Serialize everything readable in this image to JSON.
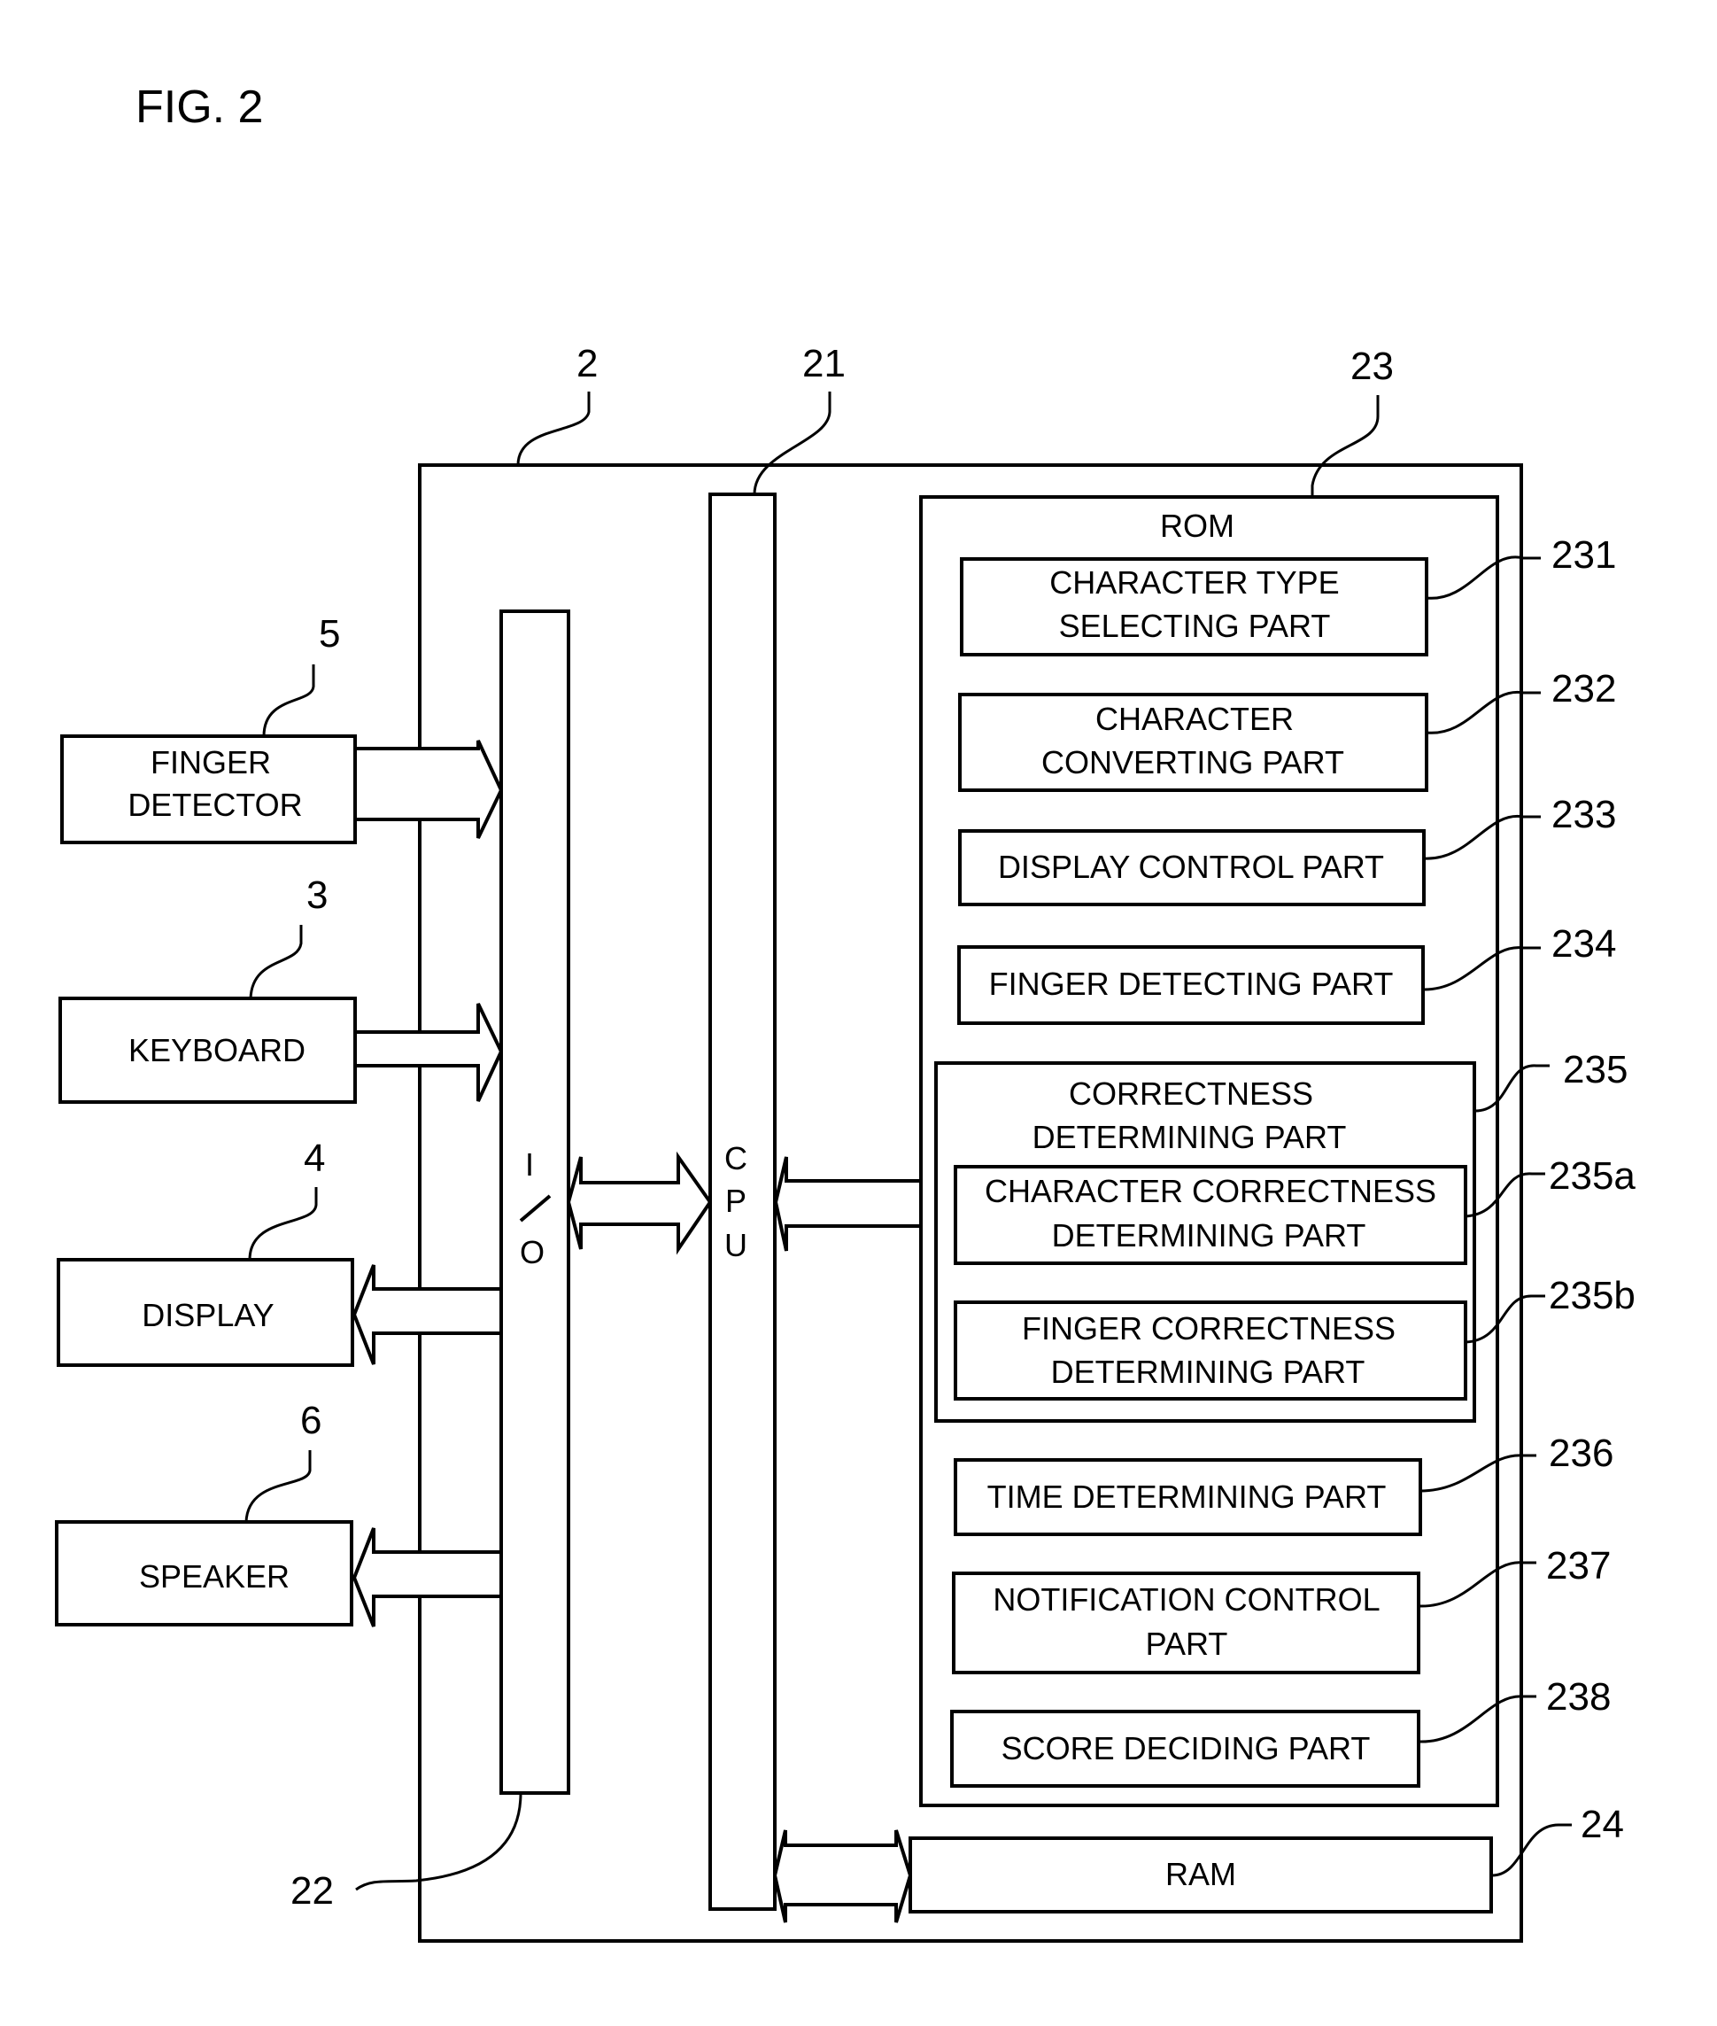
{
  "figure": {
    "title": "FIG. 2"
  },
  "refs": {
    "controller": "2",
    "cpu": "21",
    "io": "22",
    "rom": "23",
    "ram": "24",
    "finger_detector": "5",
    "keyboard": "3",
    "display": "4",
    "speaker": "6",
    "p231": "231",
    "p232": "232",
    "p233": "233",
    "p234": "234",
    "p235": "235",
    "p235a": "235a",
    "p235b": "235b",
    "p236": "236",
    "p237": "237",
    "p238": "238"
  },
  "blocks": {
    "finger_detector": [
      "FINGER",
      "DETECTOR"
    ],
    "keyboard": [
      "KEYBOARD"
    ],
    "display": [
      "DISPLAY"
    ],
    "speaker": [
      "SPEAKER"
    ],
    "io": [
      "I",
      "/",
      "O"
    ],
    "cpu": [
      "C",
      "P",
      "U"
    ],
    "rom": "ROM",
    "ram": "RAM",
    "p231": [
      "CHARACTER TYPE",
      "SELECTING PART"
    ],
    "p232": [
      "CHARACTER",
      "CONVERTING PART"
    ],
    "p233": [
      "DISPLAY CONTROL PART"
    ],
    "p234": [
      "FINGER DETECTING PART"
    ],
    "p235": [
      "CORRECTNESS",
      "DETERMINING PART"
    ],
    "p235a": [
      "CHARACTER CORRECTNESS",
      "DETERMINING PART"
    ],
    "p235b": [
      "FINGER CORRECTNESS",
      "DETERMINING PART"
    ],
    "p236": [
      "TIME DETERMINING PART"
    ],
    "p237": [
      "NOTIFICATION CONTROL",
      "PART"
    ],
    "p238": [
      "SCORE DECIDING PART"
    ]
  }
}
